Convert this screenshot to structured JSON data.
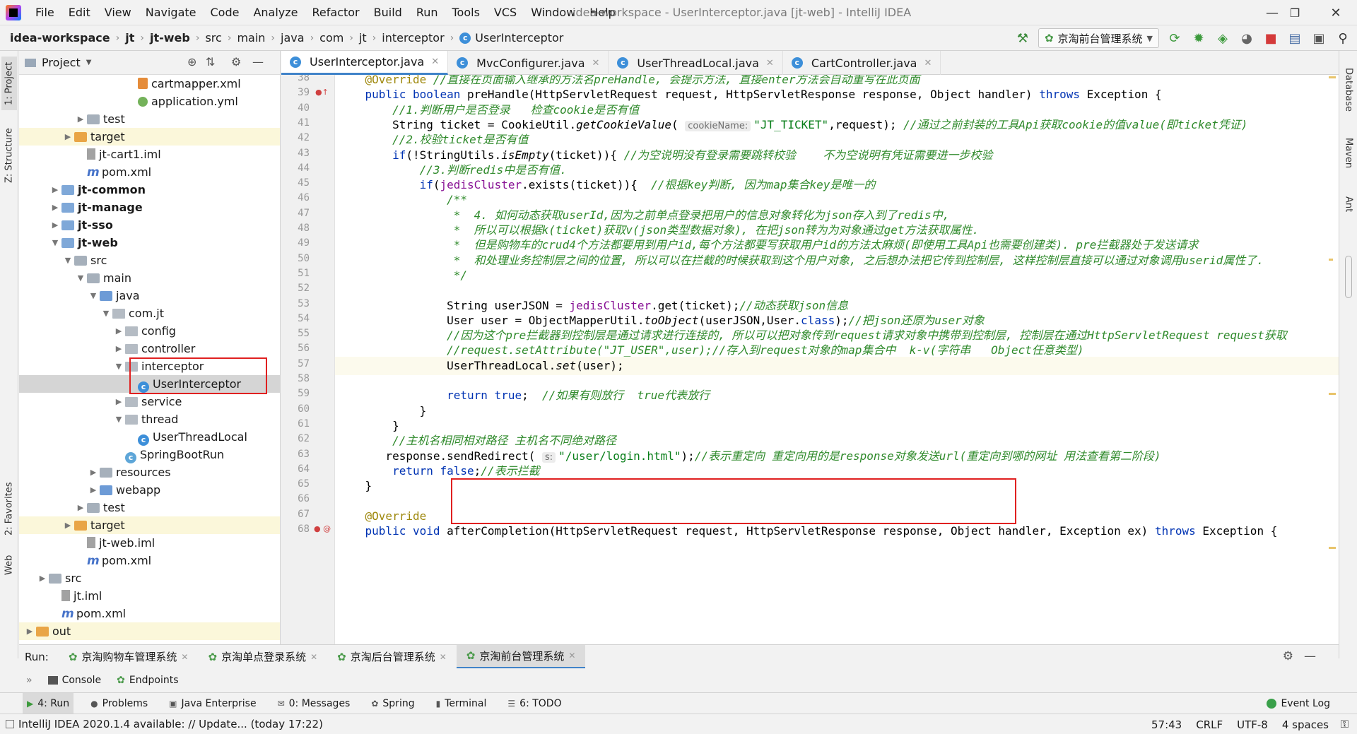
{
  "menu": [
    "File",
    "Edit",
    "View",
    "Navigate",
    "Code",
    "Analyze",
    "Refactor",
    "Build",
    "Run",
    "Tools",
    "VCS",
    "Window",
    "Help"
  ],
  "window_title": "idea-workspace - UserInterceptor.java [jt-web] - IntelliJ IDEA",
  "breadcrumbs": [
    "idea-workspace",
    "jt",
    "jt-web",
    "src",
    "main",
    "java",
    "com",
    "jt",
    "interceptor",
    "UserInterceptor"
  ],
  "run_config": "京淘前台管理系统",
  "left_stripe": [
    "1: Project",
    "Z: Structure",
    "2: Favorites",
    "Web"
  ],
  "right_stripe": [
    "Database",
    "Maven",
    "Ant"
  ],
  "project_panel": {
    "title": "Project",
    "tree": [
      {
        "label": "cartmapper.xml",
        "indent": 9,
        "icon": "xml"
      },
      {
        "label": "application.yml",
        "indent": 9,
        "icon": "yml"
      },
      {
        "label": "test",
        "indent": 5,
        "icon": "folder",
        "arrow": "▶"
      },
      {
        "label": "target",
        "indent": 4,
        "icon": "folder-orange",
        "arrow": "▶",
        "excluded": true
      },
      {
        "label": "jt-cart1.iml",
        "indent": 5,
        "icon": "iml"
      },
      {
        "label": "pom.xml",
        "indent": 5,
        "icon": "maven"
      },
      {
        "label": "jt-common",
        "indent": 3,
        "icon": "module",
        "arrow": "▶",
        "bold": true
      },
      {
        "label": "jt-manage",
        "indent": 3,
        "icon": "module",
        "arrow": "▶",
        "bold": true
      },
      {
        "label": "jt-sso",
        "indent": 3,
        "icon": "module",
        "arrow": "▶",
        "bold": true
      },
      {
        "label": "jt-web",
        "indent": 3,
        "icon": "module",
        "arrow": "▼",
        "bold": true
      },
      {
        "label": "src",
        "indent": 4,
        "icon": "folder",
        "arrow": "▼"
      },
      {
        "label": "main",
        "indent": 5,
        "icon": "folder",
        "arrow": "▼"
      },
      {
        "label": "java",
        "indent": 6,
        "icon": "folder-blue",
        "arrow": "▼"
      },
      {
        "label": "com.jt",
        "indent": 7,
        "icon": "package",
        "arrow": "▼"
      },
      {
        "label": "config",
        "indent": 8,
        "icon": "package",
        "arrow": "▶"
      },
      {
        "label": "controller",
        "indent": 8,
        "icon": "package",
        "arrow": "▶"
      },
      {
        "label": "interceptor",
        "indent": 8,
        "icon": "package",
        "arrow": "▼"
      },
      {
        "label": "UserInterceptor",
        "indent": 9,
        "icon": "class",
        "selected": true
      },
      {
        "label": "service",
        "indent": 8,
        "icon": "package",
        "arrow": "▶"
      },
      {
        "label": "thread",
        "indent": 8,
        "icon": "package",
        "arrow": "▼"
      },
      {
        "label": "UserThreadLocal",
        "indent": 9,
        "icon": "class"
      },
      {
        "label": "SpringBootRun",
        "indent": 8,
        "icon": "class-spring"
      },
      {
        "label": "resources",
        "indent": 6,
        "icon": "folder",
        "arrow": "▶"
      },
      {
        "label": "webapp",
        "indent": 6,
        "icon": "folder-blue",
        "arrow": "▶"
      },
      {
        "label": "test",
        "indent": 5,
        "icon": "folder",
        "arrow": "▶"
      },
      {
        "label": "target",
        "indent": 4,
        "icon": "folder-orange",
        "arrow": "▶",
        "excluded": true
      },
      {
        "label": "jt-web.iml",
        "indent": 5,
        "icon": "iml"
      },
      {
        "label": "pom.xml",
        "indent": 5,
        "icon": "maven"
      },
      {
        "label": "src",
        "indent": 2,
        "icon": "folder",
        "arrow": "▶"
      },
      {
        "label": "jt.iml",
        "indent": 3,
        "icon": "iml"
      },
      {
        "label": "pom.xml",
        "indent": 3,
        "icon": "maven"
      },
      {
        "label": "out",
        "indent": 1,
        "icon": "folder-orange",
        "arrow": "▶",
        "excluded": true
      }
    ]
  },
  "editor_tabs": [
    {
      "label": "UserInterceptor.java",
      "active": true
    },
    {
      "label": "MvcConfigurer.java",
      "active": false
    },
    {
      "label": "UserThreadLocal.java",
      "active": false
    },
    {
      "label": "CartController.java",
      "active": false
    }
  ],
  "editor": {
    "line_numbers": [
      "38",
      "39",
      "40",
      "41",
      "42",
      "43",
      "44",
      "45",
      "46",
      "47",
      "48",
      "49",
      "50",
      "51",
      "52",
      "53",
      "54",
      "55",
      "56",
      "57",
      "58",
      "59",
      "60",
      "61",
      "62",
      "63",
      "64",
      "65",
      "66",
      "67",
      "68"
    ],
    "code": [
      [
        {
          "t": "    "
        },
        {
          "t": "@Override ",
          "c": "ann"
        },
        {
          "t": "//直接在页面输入继承的方法名preHandle, 会提示方法, 直接enter方法会自动重写在此页面",
          "c": "cm"
        }
      ],
      [
        {
          "t": "    "
        },
        {
          "t": "public boolean ",
          "c": "kw"
        },
        {
          "t": "preHandle(HttpServletRequest request, HttpServletResponse response, Object handler) "
        },
        {
          "t": "throws ",
          "c": "kw"
        },
        {
          "t": "Exception {"
        }
      ],
      [
        {
          "t": "        "
        },
        {
          "t": "//1.判断用户是否登录   检查cookie是否有值",
          "c": "cm"
        }
      ],
      [
        {
          "t": "        String ticket = CookieUtil."
        },
        {
          "t": "getCookieValue",
          "c": "it"
        },
        {
          "t": "( "
        },
        {
          "t": "cookieName:",
          "c": "hint"
        },
        {
          "t": "\"JT_TICKET\"",
          "c": "str"
        },
        {
          "t": ",request); "
        },
        {
          "t": "//通过之前封装的工具Api获取cookie的值value(即ticket凭证)",
          "c": "cm"
        }
      ],
      [
        {
          "t": "        "
        },
        {
          "t": "//2.校验ticket是否有值",
          "c": "cm"
        }
      ],
      [
        {
          "t": "        "
        },
        {
          "t": "if",
          "c": "kw"
        },
        {
          "t": "(!StringUtils."
        },
        {
          "t": "isEmpty",
          "c": "it"
        },
        {
          "t": "(ticket)){ "
        },
        {
          "t": "//为空说明没有登录需要跳转校验    不为空说明有凭证需要进一步校验",
          "c": "cm"
        }
      ],
      [
        {
          "t": "            "
        },
        {
          "t": "//3.判断redis中是否有值.",
          "c": "cm"
        }
      ],
      [
        {
          "t": "            "
        },
        {
          "t": "if",
          "c": "kw"
        },
        {
          "t": "("
        },
        {
          "t": "jedisCluster",
          "c": "fld"
        },
        {
          "t": ".exists(ticket)){  "
        },
        {
          "t": "//根据key判断, 因为map集合key是唯一的",
          "c": "cm"
        }
      ],
      [
        {
          "t": "                "
        },
        {
          "t": "/**",
          "c": "cm"
        }
      ],
      [
        {
          "t": "                 "
        },
        {
          "t": "*  4. 如何动态获取userId,因为之前单点登录把用户的信息对象转化为json存入到了redis中,",
          "c": "cm"
        }
      ],
      [
        {
          "t": "                 "
        },
        {
          "t": "*  所以可以根据k(ticket)获取v(json类型数据对象), 在把json转为为对象通过get方法获取属性.",
          "c": "cm"
        }
      ],
      [
        {
          "t": "                 "
        },
        {
          "t": "*  但是购物车的crud4个方法都要用到用户id,每个方法都要写获取用户id的方法太麻烦(即使用工具Api也需要创建类). pre拦截器处于发送请求",
          "c": "cm"
        }
      ],
      [
        {
          "t": "                 "
        },
        {
          "t": "*  和处理业务控制层之间的位置, 所以可以在拦截的时候获取到这个用户对象, 之后想办法把它传到控制层, 这样控制层直接可以通过对象调用userid属性了.",
          "c": "cm"
        }
      ],
      [
        {
          "t": "                 "
        },
        {
          "t": "*/",
          "c": "cm"
        }
      ],
      [
        {
          "t": ""
        }
      ],
      [
        {
          "t": "                String userJSON = "
        },
        {
          "t": "jedisCluster",
          "c": "fld"
        },
        {
          "t": ".get(ticket);"
        },
        {
          "t": "//动态获取json信息",
          "c": "cm"
        }
      ],
      [
        {
          "t": "                User user = ObjectMapperUtil."
        },
        {
          "t": "toObject",
          "c": "it"
        },
        {
          "t": "(userJSON,User."
        },
        {
          "t": "class",
          "c": "kw"
        },
        {
          "t": ");"
        },
        {
          "t": "//把json还原为user对象",
          "c": "cm"
        }
      ],
      [
        {
          "t": "                "
        },
        {
          "t": "//因为这个pre拦截器到控制层是通过请求进行连接的, 所以可以把对象传到request请求对象中携带到控制层, 控制层在通过HttpServletRequest request获取",
          "c": "cm"
        }
      ],
      [
        {
          "t": "                "
        },
        {
          "t": "//request.setAttribute(\"JT_USER\",user);//存入到request对象的map集合中  k-v(字符串   Object任意类型)",
          "c": "cm"
        }
      ],
      [
        {
          "t": "                UserThreadLocal."
        },
        {
          "t": "set",
          "c": "it"
        },
        {
          "t": "(user);"
        }
      ],
      [
        {
          "t": ""
        }
      ],
      [
        {
          "t": "                "
        },
        {
          "t": "return true",
          "c": "kw"
        },
        {
          "t": ";  "
        },
        {
          "t": "//如果有则放行  true代表放行",
          "c": "cm"
        }
      ],
      [
        {
          "t": "            }"
        }
      ],
      [
        {
          "t": "        }"
        }
      ],
      [
        {
          "t": "        "
        },
        {
          "t": "//主机名相同相对路径 主机名不同绝对路径",
          "c": "cm"
        }
      ],
      [
        {
          "t": "       response.sendRedirect( "
        },
        {
          "t": "s:",
          "c": "hint"
        },
        {
          "t": "\"/user/login.html\"",
          "c": "str"
        },
        {
          "t": ");"
        },
        {
          "t": "//表示重定向 重定向用的是response对象发送url(重定向到哪的网址 用法查看第二阶段)",
          "c": "cm"
        }
      ],
      [
        {
          "t": "        "
        },
        {
          "t": "return false",
          "c": "kw"
        },
        {
          "t": ";"
        },
        {
          "t": "//表示拦截",
          "c": "cm"
        }
      ],
      [
        {
          "t": "    }"
        }
      ],
      [
        {
          "t": ""
        }
      ],
      [
        {
          "t": "    "
        },
        {
          "t": "@Override",
          "c": "ann"
        }
      ],
      [
        {
          "t": "    "
        },
        {
          "t": "public void ",
          "c": "kw"
        },
        {
          "t": "afterCompletion(HttpServletRequest request, HttpServletResponse response, Object handler, Exception ex) "
        },
        {
          "t": "throws ",
          "c": "kw"
        },
        {
          "t": "Exception {"
        }
      ]
    ]
  },
  "run_panel": {
    "label": "Run:",
    "tabs": [
      "京淘购物车管理系统",
      "京淘单点登录系统",
      "京淘后台管理系统",
      "京淘前台管理系统"
    ],
    "active_tab": 3,
    "sub_tabs": [
      "Console",
      "Endpoints"
    ]
  },
  "tool_strip": [
    "4: Run",
    "Problems",
    "Java Enterprise",
    "0: Messages",
    "Spring",
    "Terminal",
    "6: TODO"
  ],
  "event_log": "Event Log",
  "status": {
    "message": "IntelliJ IDEA 2020.1.4 available: // Update... (today 17:22)",
    "position": "57:43",
    "line_sep": "CRLF",
    "encoding": "UTF-8",
    "indent": "4 spaces"
  }
}
